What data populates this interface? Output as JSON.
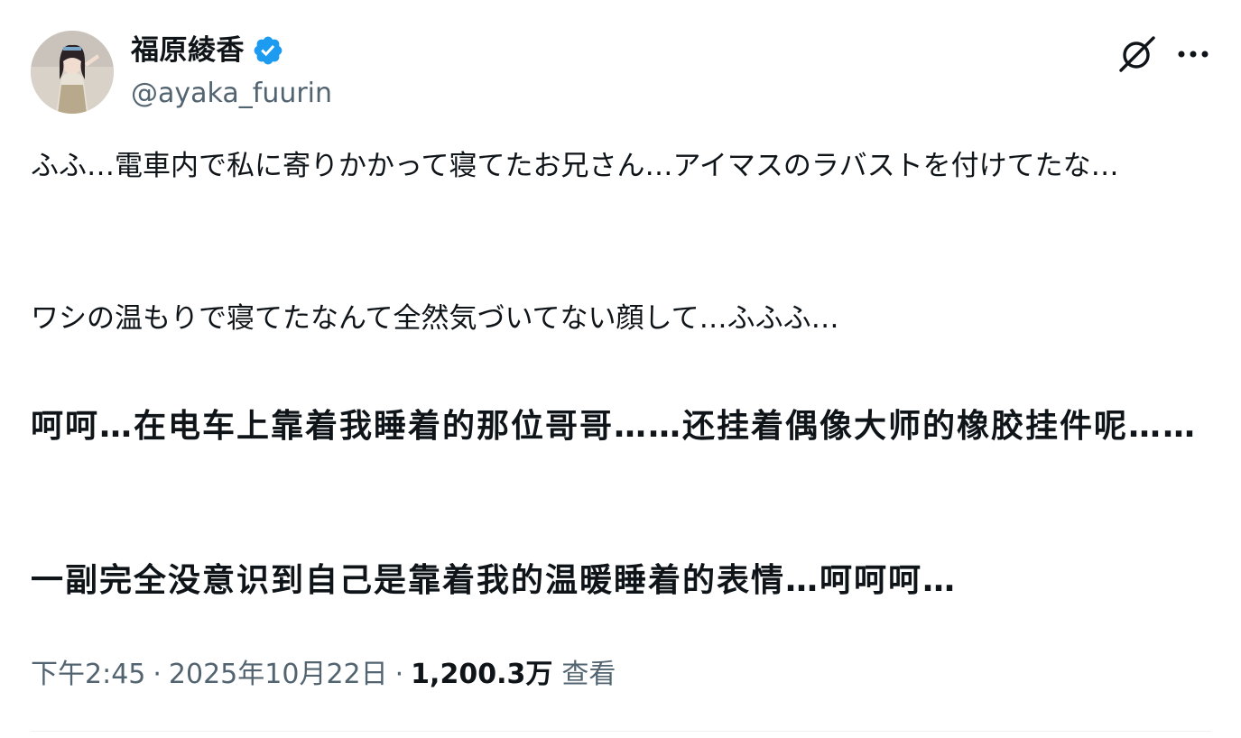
{
  "author": {
    "display_name": "福原綾香",
    "handle": "@ayaka_fuurin",
    "verified": true,
    "verified_color": "#1d9bf0"
  },
  "actions": {
    "grok_icon": "grok-icon",
    "more_icon": "more-icon"
  },
  "tweet": {
    "paragraphs_jp": [
      "ふふ…電車内で私に寄りかかって寝てたお兄さん…アイマスのラバストを付けてたな…",
      "ワシの温もりで寝てたなんて全然気づいてない顔して…ふふふ…"
    ],
    "paragraphs_cn": [
      "呵呵…在电车上靠着我睡着的那位哥哥……还挂着偶像大师的橡胶挂件呢……",
      "一副完全没意识到自己是靠着我的温暖睡着的表情…呵呵呵…"
    ]
  },
  "meta": {
    "time": "下午2:45",
    "date": "2025年10月22日",
    "separator": "·",
    "views_count": "1,200.3万",
    "views_label": "查看"
  },
  "colors": {
    "text_primary": "#0f1419",
    "text_secondary": "#536471",
    "divider": "#eff3f4"
  }
}
